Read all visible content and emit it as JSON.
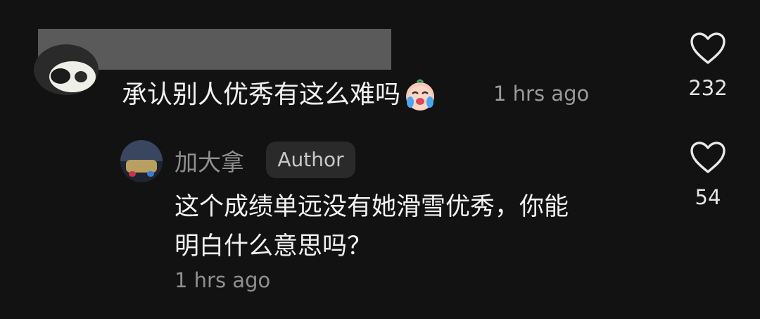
{
  "comment": {
    "text": "承认别人优秀有这么难吗",
    "emoji": "crying-face-emoji",
    "time": "1 hrs ago",
    "likes": "232"
  },
  "reply": {
    "username": "加大拿",
    "badge": "Author",
    "text_line1": "这个成绩单远没有她滑雪优秀，你能",
    "text_line2": "明白什么意思吗？",
    "time": "1 hrs ago",
    "likes": "54"
  },
  "colors": {
    "background": "#121212",
    "primary_text": "#f2f2f2",
    "secondary_text": "#8f8f8f",
    "badge_bg": "#2a2a2a"
  },
  "icons": {
    "like": "heart-outline-icon"
  }
}
